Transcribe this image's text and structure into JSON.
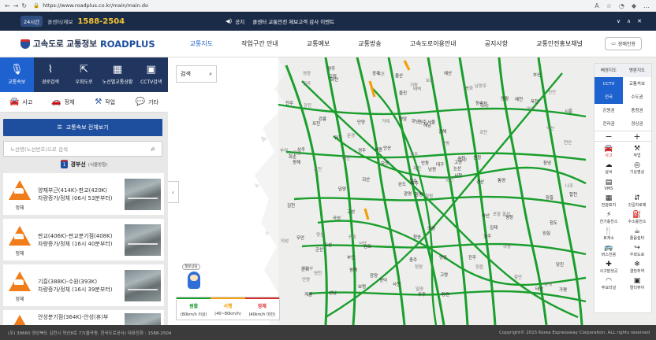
{
  "browser": {
    "url": "https://www.roadplus.co.kr/main/main.do",
    "back": "←",
    "forward": "→",
    "reload": "↻",
    "lock": "🔒",
    "icons": [
      "A",
      "☆",
      "◔",
      "◆",
      "…"
    ]
  },
  "topbar": {
    "hours": "24시간",
    "call_center": "콜센터/제보",
    "phone": "1588-2504",
    "notice_label": "공지",
    "notice_text": "콜센터 교통안전 제보고객 감사 이벤트",
    "controls": [
      "∨",
      "∧",
      "✕"
    ]
  },
  "header": {
    "logo_text": "고속도로 교통정보",
    "logo_brand": "ROADPLUS",
    "menu": [
      "교통지도",
      "작업구간 안내",
      "교통예보",
      "교통방송",
      "고속도로이용안내",
      "공지사항",
      "교통안전홍보채널"
    ],
    "disabled_btn": "장애인용"
  },
  "sidebar": {
    "tabs": [
      "교통속보",
      "경로검색",
      "우회도로",
      "노선별교통상황",
      "CCTV검색"
    ],
    "filters": [
      "사고",
      "정체",
      "작업",
      "기타"
    ],
    "all_btn": "교통속보 전체보기",
    "search_placeholder": "노선명(노선번호)으로 검색",
    "route_badge": "1",
    "route_name": "경부선",
    "route_dir": "(서울방향)",
    "warn_label": "정체",
    "cards": [
      {
        "line1": "양재부근(414K)-판교(420K)",
        "line2": "차량증가/정체 (06시 53분부터)"
      },
      {
        "line1": "판교(406K)-판교분기점(408K)",
        "line2": "차량증가/정체 (16시 40분부터)"
      },
      {
        "line1": "기흥(388K)-수원(393K)",
        "line2": "차량증가/정체 (16시 39분부터)"
      },
      {
        "line1": "안성분기점(364K)-안성(휴)부",
        "line2": ""
      }
    ]
  },
  "map": {
    "search_label": "검색",
    "panel": {
      "row1": [
        "배경지도",
        "명판지도"
      ],
      "row2": [
        "CCTV",
        "교통속보"
      ],
      "row3": [
        "전국",
        "수도권"
      ],
      "row4": [
        "강원권",
        "충청권"
      ],
      "row5": [
        "전라권",
        "경상권"
      ],
      "zoom_minus": "−",
      "zoom_plus": "+",
      "items": [
        "사고",
        "작업",
        "날씨",
        "기상영상",
        "VMS",
        "",
        "전광표지",
        "갓길차로제",
        "전기충전소",
        "수소충전소",
        "휴게소",
        "졸음쉼터",
        "버스전용",
        "우회도로",
        "사고발생곳",
        "결빙취약",
        "주요터널",
        "멀티뷰어"
      ]
    },
    "legend": [
      {
        "label": "원활",
        "range": "(80km/h 이상)",
        "color": "#1a9e2c"
      },
      {
        "label": "서행",
        "range": "(40~80km/h)",
        "color": "#f2a007"
      },
      {
        "label": "정체",
        "range": "(40km/h 미만)",
        "color": "#d32f2f"
      }
    ],
    "mascot_bubble": "챗봇상담",
    "labels": [
      "철원",
      "포천",
      "파주",
      "의정부",
      "고양",
      "김포",
      "남양주",
      "서울",
      "인천",
      "춘천",
      "화천",
      "가평",
      "홍천",
      "시흥",
      "광명",
      "과천",
      "성남",
      "하남",
      "양평",
      "오산",
      "안산",
      "안양",
      "평택",
      "원주",
      "횡성",
      "평창",
      "강릉",
      "태백",
      "동해",
      "아산",
      "천안",
      "청주",
      "충주",
      "제천",
      "단양",
      "영월",
      "서산",
      "태안",
      "당진",
      "홍성",
      "예산",
      "세종",
      "대전",
      "공주",
      "보령",
      "부여",
      "논산",
      "계룡",
      "청양",
      "서천",
      "군산",
      "익산",
      "전주",
      "김제",
      "정읍",
      "부안",
      "고창",
      "영광",
      "영동",
      "옥천",
      "보은",
      "괴산",
      "상주",
      "문경",
      "예천",
      "영주",
      "봉화",
      "울진",
      "안동",
      "의성",
      "청송",
      "영덕",
      "포항",
      "경주",
      "군위",
      "칠곡",
      "구미",
      "김천",
      "성주",
      "고령",
      "대구",
      "영천",
      "경산",
      "청도",
      "밀양",
      "창녕",
      "의령",
      "함안",
      "창원",
      "진주",
      "거창",
      "합천",
      "산청",
      "하동",
      "남원",
      "임실",
      "진안",
      "무주",
      "장수",
      "순창",
      "담양",
      "광주",
      "나주",
      "화순",
      "곡성",
      "구례",
      "광양",
      "순천",
      "여수",
      "보성",
      "장흥",
      "강진",
      "해남",
      "완도",
      "목포",
      "무안",
      "함평",
      "신안",
      "영암",
      "울산",
      "양산",
      "부산",
      "김해",
      "거제",
      "통영",
      "고성",
      "남해",
      "사천"
    ]
  },
  "footer": {
    "text": "(우) 39660 경상북도 김천시 혁신8로 77(율곡동, 한국도로공사) 대표전화 : 1588-2504",
    "copyright": "Copyright© 2015 Korea Expressway Corporation. ALL rights reserved"
  },
  "colors": {
    "accent": "#1e62d0",
    "navy": "#1a2b47",
    "green": "#1a9e2c",
    "orange": "#f07d1a",
    "red": "#d32f2f"
  }
}
